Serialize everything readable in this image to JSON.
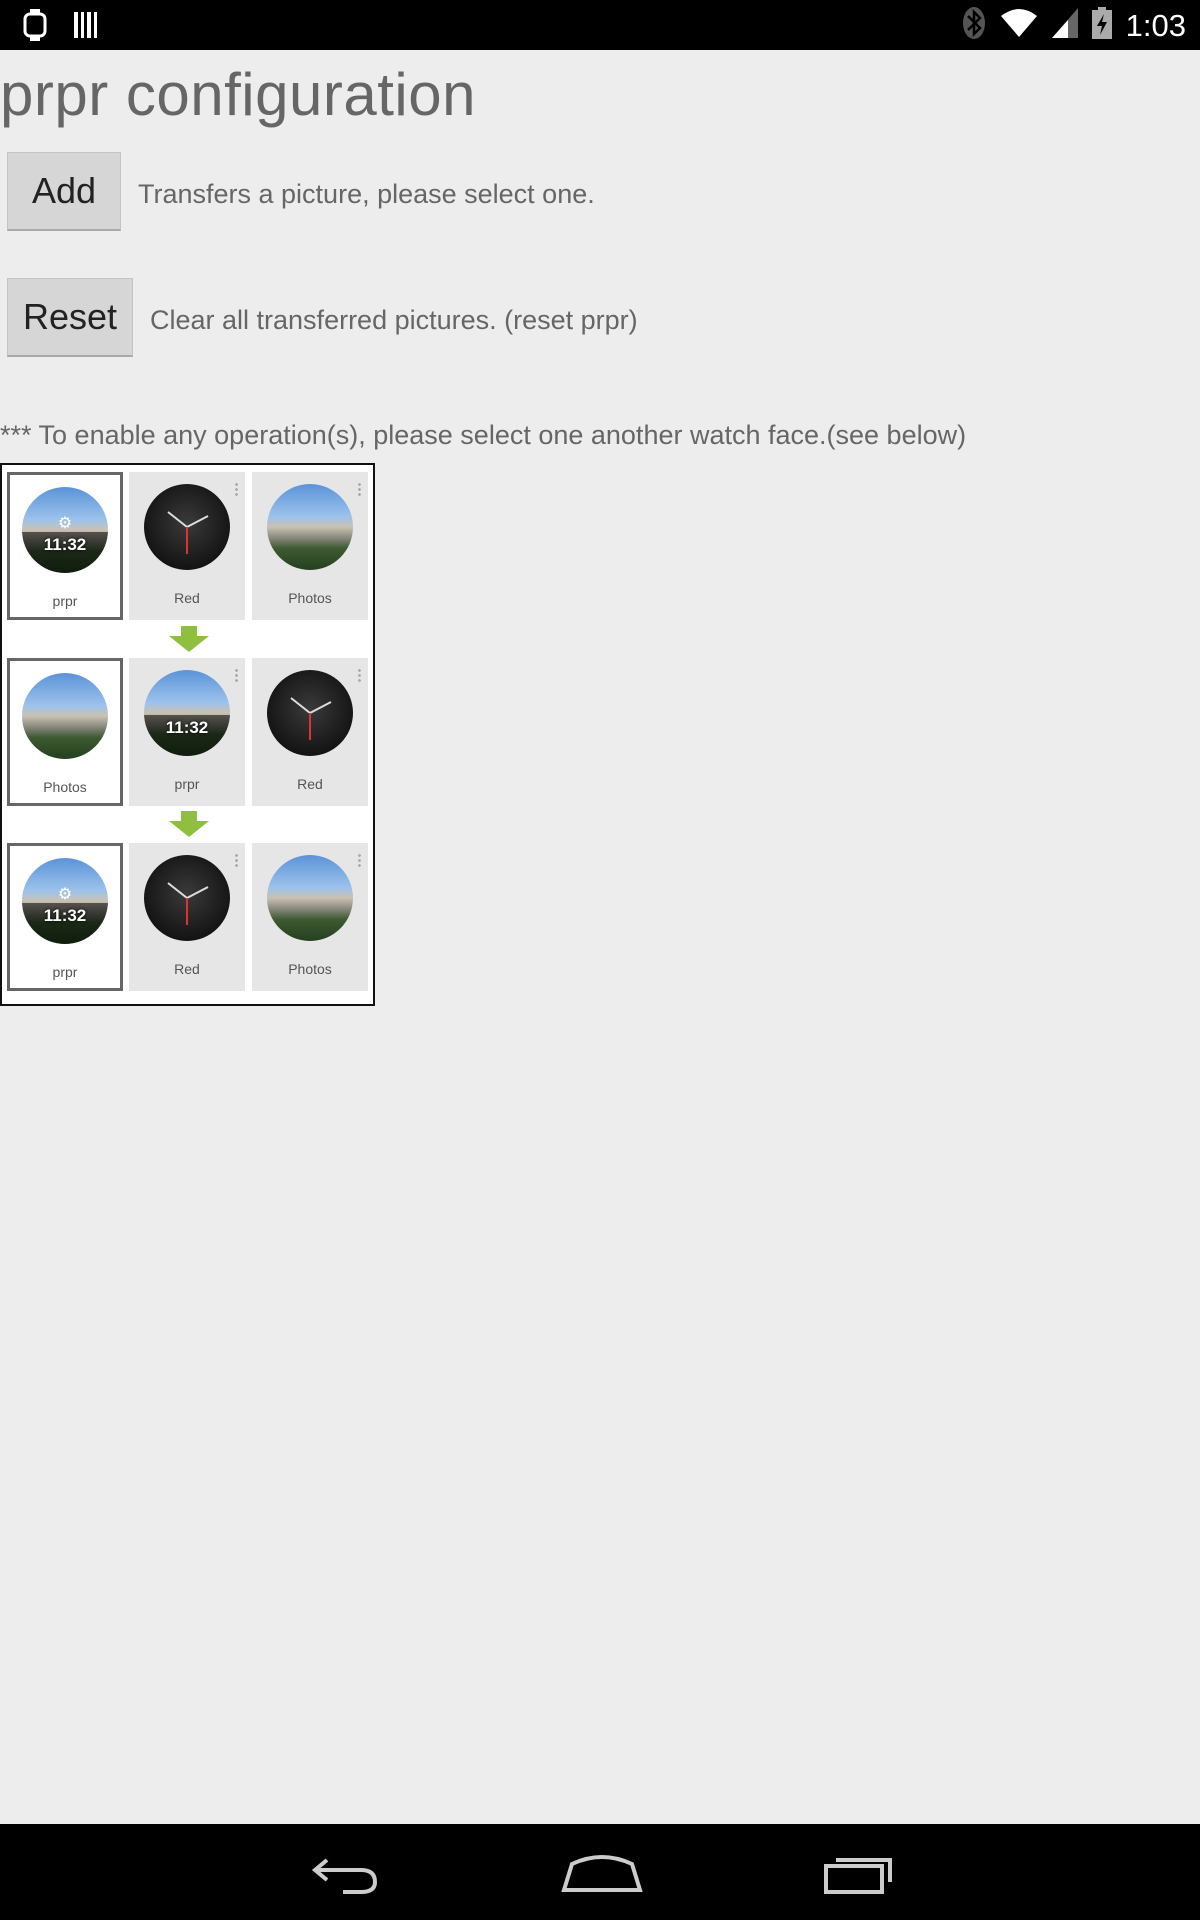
{
  "status_bar": {
    "left_icons": [
      "android-wear-icon",
      "barcode-icon"
    ],
    "right_icons": [
      "bluetooth-icon",
      "wifi-icon",
      "signal-icon",
      "battery-charging-icon"
    ],
    "time": "1:03"
  },
  "page": {
    "title": "prpr configuration",
    "add_button": "Add",
    "add_desc": "Transfers a picture, please select one.",
    "reset_button": "Reset",
    "reset_desc": "Clear all transferred pictures. (reset prpr)",
    "note": "*** To enable any operation(s), please select one another watch face.(see below)"
  },
  "guide": {
    "rows": [
      [
        {
          "label": "prpr",
          "face": "photo-config",
          "time": "11:32",
          "selected": true
        },
        {
          "label": "Red",
          "face": "dark"
        },
        {
          "label": "Photos",
          "face": "photo"
        }
      ],
      [
        {
          "label": "Photos",
          "face": "photo",
          "selected": true
        },
        {
          "label": "prpr",
          "face": "photo-time",
          "time": "11:32"
        },
        {
          "label": "Red",
          "face": "dark"
        }
      ],
      [
        {
          "label": "prpr",
          "face": "photo-config",
          "time": "11:32",
          "selected": true
        },
        {
          "label": "Red",
          "face": "dark"
        },
        {
          "label": "Photos",
          "face": "photo"
        }
      ]
    ],
    "arrow_color": "#8fbf3f"
  },
  "nav_bar": {
    "buttons": [
      "back-icon",
      "home-icon",
      "recent-apps-icon"
    ]
  }
}
